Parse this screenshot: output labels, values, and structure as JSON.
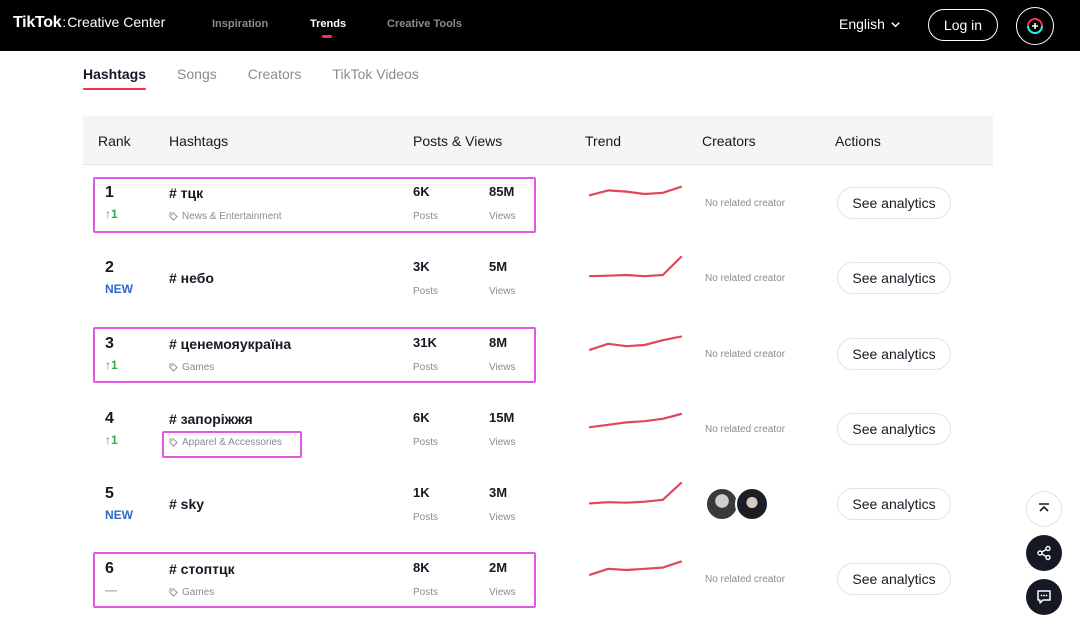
{
  "header": {
    "brand_logo": "TikTok",
    "brand_sep": ":",
    "brand_sub": "Creative Center",
    "nav": [
      {
        "label": "Inspiration",
        "active": false
      },
      {
        "label": "Trends",
        "active": true
      },
      {
        "label": "Creative Tools",
        "active": false
      }
    ],
    "language": "English",
    "login_label": "Log in",
    "profile_icon": "creative-center-badge-icon"
  },
  "tabs": [
    {
      "label": "Hashtags",
      "active": true
    },
    {
      "label": "Songs",
      "active": false
    },
    {
      "label": "Creators",
      "active": false
    },
    {
      "label": "TikTok Videos",
      "active": false
    }
  ],
  "table": {
    "columns": {
      "rank": "Rank",
      "hashtags": "Hashtags",
      "posts_views": "Posts & Views",
      "trend": "Trend",
      "creators": "Creators",
      "actions": "Actions"
    },
    "posts_label": "Posts",
    "views_label": "Views",
    "no_creator_label": "No related creator",
    "analytics_label": "See analytics",
    "trend_color": "#e0475b",
    "rows": [
      {
        "rank": "1",
        "change": "↑1",
        "change_type": "up",
        "hashtag": "# тцк",
        "industry": "News & Entertainment",
        "posts": "6K",
        "views": "85M",
        "creators": "none",
        "trend": [
          0.45,
          0.65,
          0.6,
          0.5,
          0.55,
          0.8
        ]
      },
      {
        "rank": "2",
        "change": "NEW",
        "change_type": "new",
        "hashtag": "# небо",
        "industry": "",
        "posts": "3K",
        "views": "5M",
        "creators": "none",
        "trend": [
          0.2,
          0.22,
          0.25,
          0.2,
          0.25,
          1.0
        ]
      },
      {
        "rank": "3",
        "change": "↑1",
        "change_type": "up",
        "hashtag": "# ценемояукраїна",
        "industry": "Games",
        "posts": "31K",
        "views": "8M",
        "creators": "none",
        "trend": [
          0.3,
          0.55,
          0.45,
          0.5,
          0.7,
          0.85
        ]
      },
      {
        "rank": "4",
        "change": "↑1",
        "change_type": "up",
        "hashtag": "# запоріжжя",
        "industry": "Apparel & Accessories",
        "posts": "6K",
        "views": "15M",
        "creators": "none",
        "trend": [
          0.2,
          0.3,
          0.4,
          0.45,
          0.55,
          0.75
        ]
      },
      {
        "rank": "5",
        "change": "NEW",
        "change_type": "new",
        "hashtag": "# sky",
        "industry": "",
        "posts": "1K",
        "views": "3M",
        "creators": "avatars",
        "trend": [
          0.15,
          0.2,
          0.18,
          0.22,
          0.3,
          1.0
        ]
      },
      {
        "rank": "6",
        "change": "—",
        "change_type": "same",
        "hashtag": "# стоптцк",
        "industry": "Games",
        "posts": "8K",
        "views": "2M",
        "creators": "none",
        "trend": [
          0.3,
          0.55,
          0.5,
          0.55,
          0.6,
          0.85
        ]
      }
    ]
  },
  "floating": {
    "back_to_top_icon": "back-to-top-icon",
    "share_icon": "share-icon",
    "feedback_icon": "feedback-chat-icon"
  }
}
